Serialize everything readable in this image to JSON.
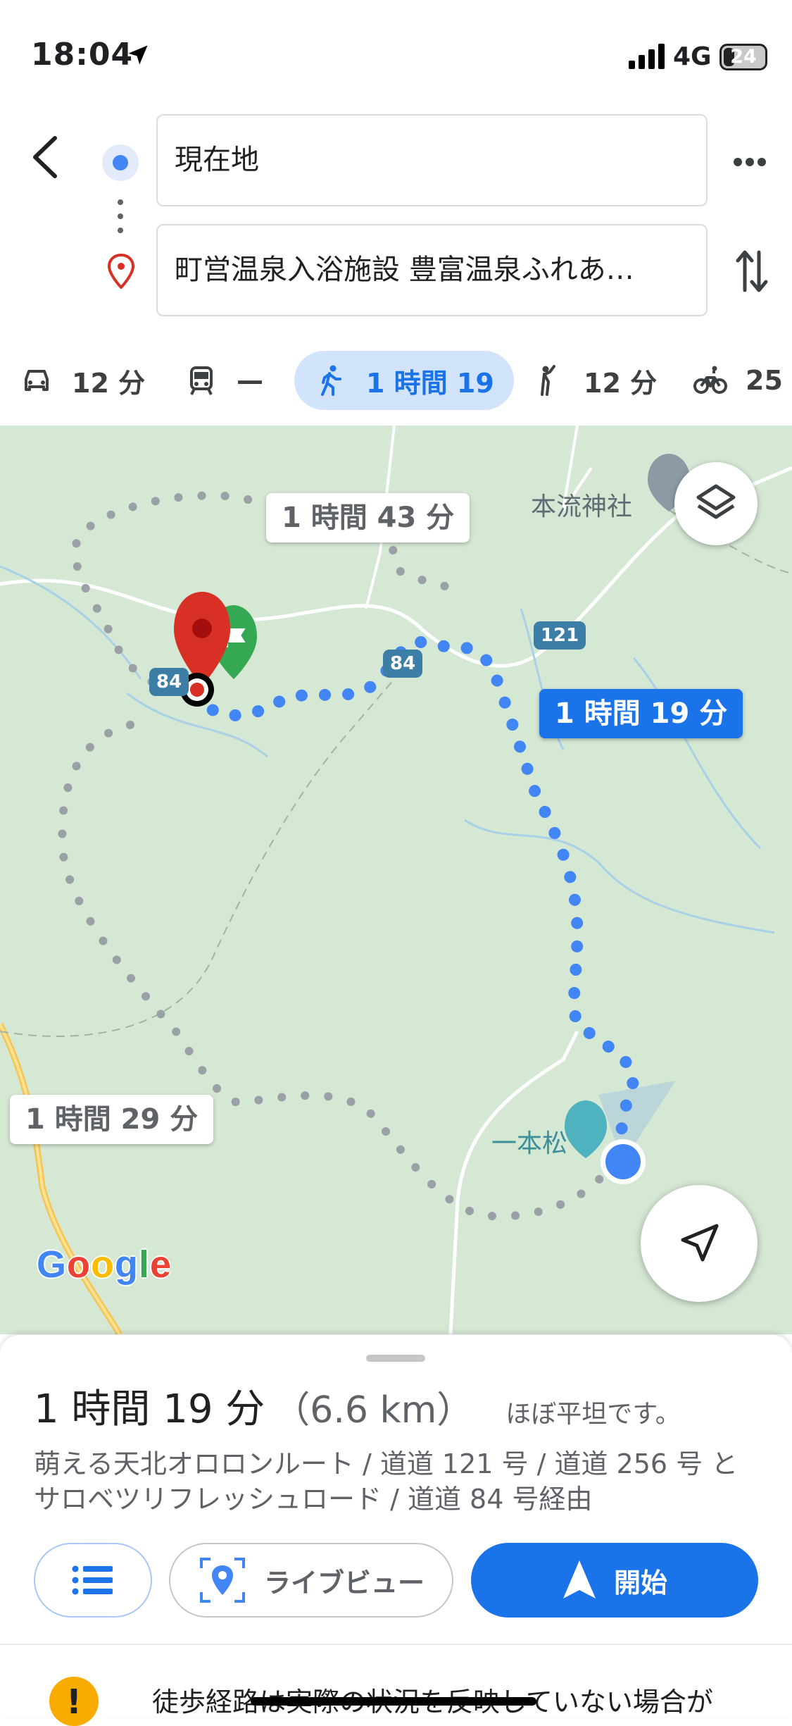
{
  "status_bar": {
    "time": "18:04",
    "network": "4G",
    "battery": "24"
  },
  "header": {
    "origin": "現在地",
    "destination": "町営温泉入浴施設 豊富温泉ふれあ…"
  },
  "modes": [
    {
      "name": "car",
      "label": "12 分"
    },
    {
      "name": "transit",
      "label": "—"
    },
    {
      "name": "walk",
      "label": "1 時間 19",
      "active": true
    },
    {
      "name": "ride",
      "label": "12 分"
    },
    {
      "name": "bike",
      "label": "25"
    }
  ],
  "map": {
    "alt_route_1": "1 時間 43 分",
    "alt_route_2": "1 時間 29 分",
    "main_route": "1 時間 19 分",
    "place_shrine": "本流神社",
    "place_pine": "一本松",
    "road_84": "84",
    "road_121": "121",
    "colors": {
      "route": "#4285f4",
      "alt_route": "#9aa0a6",
      "map_bg": "#d5e8d4"
    }
  },
  "sheet": {
    "duration": "1 時間 19 分",
    "distance": "（6.6 km）",
    "terrain": "ほぼ平坦です。",
    "via": "萌える天北オロロンルート / 道道 121 号 / 道道 256 号 と サロベツリフレッシュロード / 道道 84 号経由",
    "live_view": "ライブビュー",
    "start": "開始",
    "warning": "徒歩経路は実際の状況を反映していない場合が"
  }
}
